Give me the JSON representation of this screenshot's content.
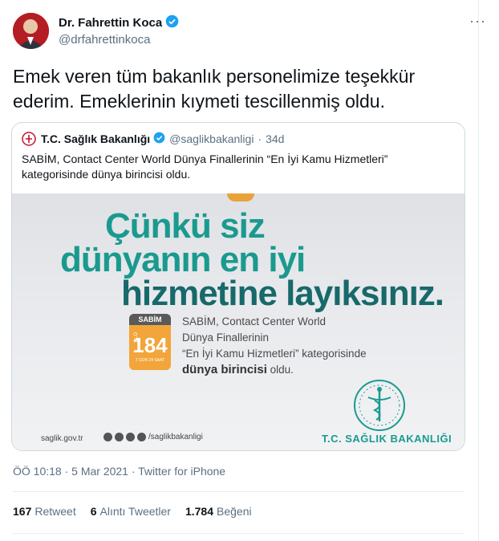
{
  "tweet": {
    "author_name": "Dr. Fahrettin Koca",
    "author_handle": "@drfahrettinkoca",
    "more_icon": "more-dots-icon",
    "text_line1": "Emek veren tüm bakanlık personelimize teşekkür",
    "text_line2": "ederim. Emeklerinin kıymeti tescillenmiş oldu.",
    "meta": "ÖÖ 10:18 · 5 Mar 2021 · Twitter for iPhone"
  },
  "quote": {
    "name": "T.C. Sağlık Bakanlığı",
    "handle": "@saglikbakanligi",
    "separator": "·",
    "time": "34d",
    "text": "SABİM, Contact Center World Dünya Finallerinin “En İyi Kamu Hizmetleri” kategorisinde dünya birincisi oldu."
  },
  "image": {
    "headline_1": "Çünkü siz",
    "headline_2": "dünyanın en iyi",
    "headline_3": "hizmetine layıksınız.",
    "badge_top": "SABİM",
    "badge_alo": "ALO",
    "badge_num": "184",
    "badge_sub": "7 GÜN 24 SAAT",
    "desc_1": "SABİM, Contact Center World",
    "desc_2": "Dünya Finallerinin",
    "desc_3": "“En İyi Kamu Hizmetleri” kategorisinde",
    "desc_4_bold": "dünya birincisi",
    "desc_4_rest": " oldu.",
    "footer_url": "saglik.gov.tr",
    "footer_social": "/saglikbakanligi",
    "footer_ministry": "T.C. SAĞLIK BAKANLIĞI"
  },
  "stats": {
    "retweets_count": "167",
    "retweets_label": "Retweet",
    "quotes_count": "6",
    "quotes_label": "Alıntı Tweetler",
    "likes_count": "1.784",
    "likes_label": "Beğeni"
  },
  "colors": {
    "verified": "#1da1f2",
    "accent_teal": "#1a9a8f",
    "badge_orange": "#f2a53a"
  }
}
